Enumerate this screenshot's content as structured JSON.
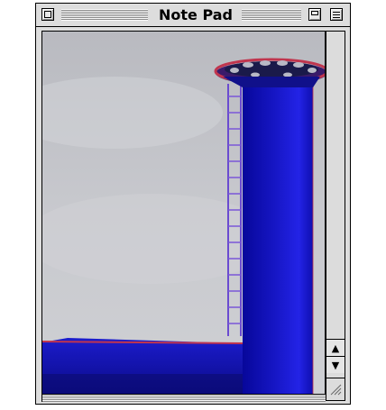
{
  "window": {
    "title": "Note Pad"
  },
  "titlebar": {
    "close_icon": "close-box-icon",
    "collapse_icon": "windowshade-icon",
    "zoom_icon": "zoom-box-icon"
  },
  "content": {
    "image_subject": "tower",
    "sky_color": "#c5c6cb",
    "tower_color": "#1515c8",
    "rim_color": "#c0354e"
  },
  "scrollbar": {
    "up_icon": "arrow-up-icon",
    "down_icon": "arrow-down-icon",
    "grow_icon": "resize-grip-icon"
  }
}
